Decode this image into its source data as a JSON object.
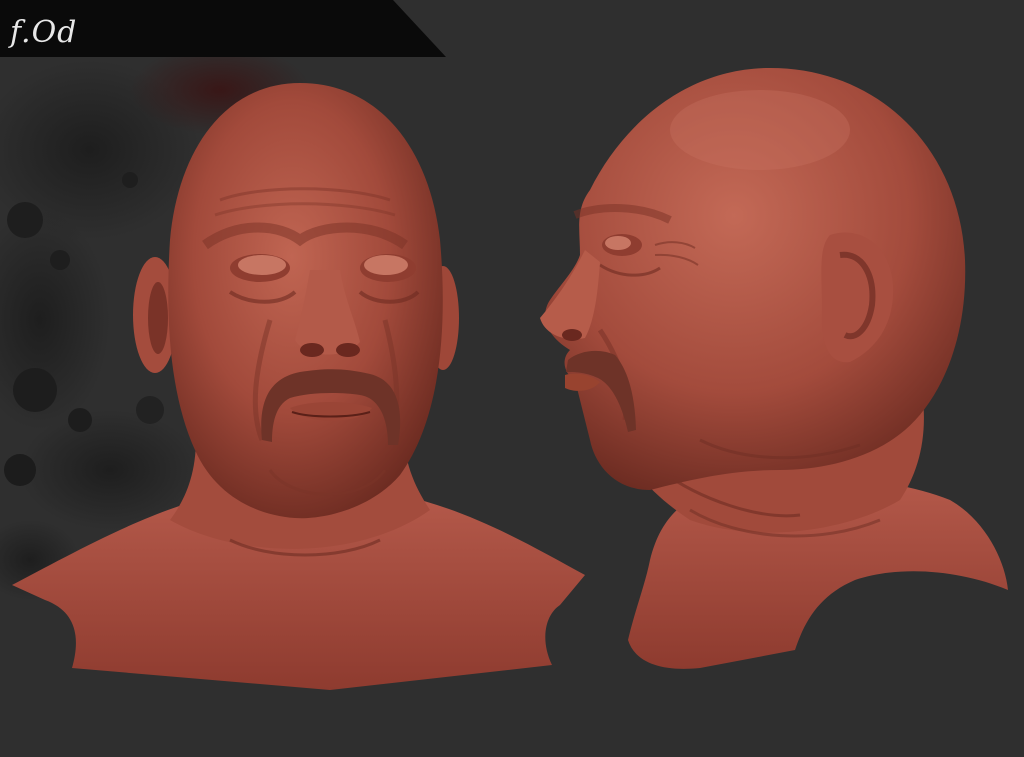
{
  "signature": "f.Od",
  "colors": {
    "background": "#2f2f2f",
    "banner": "#0a0a0a",
    "clay_mid": "#a84a3c",
    "clay_dark": "#5a2018",
    "clay_light": "#c9705e",
    "mustache": "#6e3328"
  },
  "views": [
    {
      "name": "front-view"
    },
    {
      "name": "side-view"
    }
  ]
}
